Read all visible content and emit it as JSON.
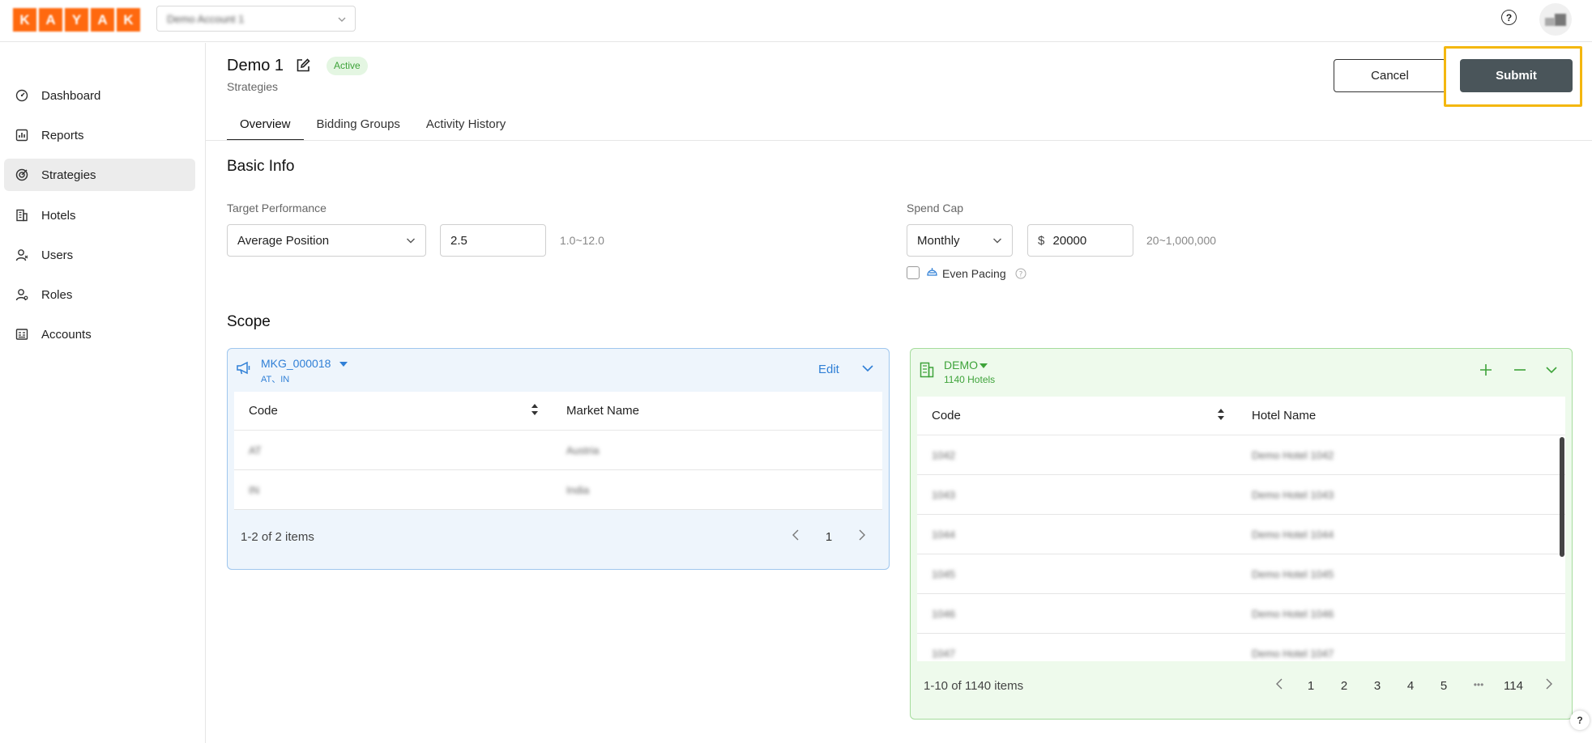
{
  "topbar": {
    "logo_letters": [
      "K",
      "A",
      "Y",
      "A",
      "K"
    ],
    "account_select_value": "Demo Account 1",
    "help_icon_glyph": "?",
    "brand_color": "#ff690f"
  },
  "sidebar": {
    "items": [
      {
        "label": "Dashboard",
        "icon": "dashboard-icon"
      },
      {
        "label": "Reports",
        "icon": "reports-icon"
      },
      {
        "label": "Strategies",
        "icon": "strategies-icon",
        "active": true
      },
      {
        "label": "Hotels",
        "icon": "hotels-icon"
      },
      {
        "label": "Users",
        "icon": "users-icon"
      },
      {
        "label": "Roles",
        "icon": "roles-icon"
      },
      {
        "label": "Accounts",
        "icon": "accounts-icon"
      }
    ]
  },
  "header": {
    "title": "Demo 1",
    "status": "Active",
    "breadcrumb": "Strategies",
    "cancel_label": "Cancel",
    "submit_label": "Submit"
  },
  "tabs": [
    {
      "label": "Overview",
      "active": true
    },
    {
      "label": "Bidding Groups"
    },
    {
      "label": "Activity History"
    }
  ],
  "basic_info": {
    "title": "Basic Info",
    "target_performance": {
      "label": "Target Performance",
      "metric": "Average Position",
      "value": "2.5",
      "range_hint": "1.0~12.0"
    },
    "spend_cap": {
      "label": "Spend Cap",
      "period": "Monthly",
      "currency": "$",
      "amount": "20000",
      "range_hint": "20~1,000,000",
      "even_pacing_label": "Even Pacing",
      "even_pacing_checked": false
    }
  },
  "scope": {
    "title": "Scope",
    "markets": {
      "id": "MKG_000018",
      "subtitle": "AT、IN",
      "edit_label": "Edit",
      "columns": [
        "Code",
        "Market Name"
      ],
      "rows": [
        {
          "code": "AT",
          "name": "Austria"
        },
        {
          "code": "IN",
          "name": "India"
        }
      ],
      "pagination": {
        "summary": "1-2 of 2 items",
        "current_page": "1"
      },
      "accent_color": "#2f7fd6"
    },
    "hotels": {
      "id": "DEMO",
      "subtitle": "1140 Hotels",
      "columns": [
        "Code",
        "Hotel Name"
      ],
      "rows": [
        {
          "code": "1042",
          "name": "Demo Hotel 1042"
        },
        {
          "code": "1043",
          "name": "Demo Hotel 1043"
        },
        {
          "code": "1044",
          "name": "Demo Hotel 1044"
        },
        {
          "code": "1045",
          "name": "Demo Hotel 1045"
        },
        {
          "code": "1046",
          "name": "Demo Hotel 1046"
        },
        {
          "code": "1047",
          "name": "Demo Hotel 1047"
        }
      ],
      "pagination": {
        "summary": "1-10 of 1140 items",
        "pages": [
          "1",
          "2",
          "3",
          "4",
          "5"
        ],
        "ellipsis": "•••",
        "last_page": "114"
      },
      "accent_color": "#3ea33a"
    }
  },
  "floating_help_glyph": "?"
}
